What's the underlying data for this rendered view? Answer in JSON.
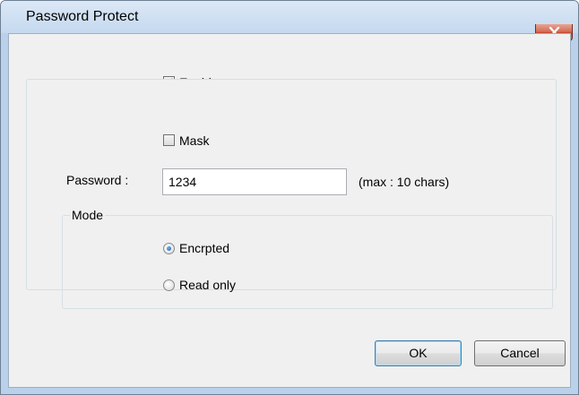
{
  "window": {
    "title": "Password Protect"
  },
  "enable": {
    "label": "Enable",
    "checked": true
  },
  "mask": {
    "label": "Mask",
    "checked": false
  },
  "password": {
    "label": "Password :",
    "value": "1234",
    "hint": "(max : 10 chars)"
  },
  "mode": {
    "title": "Mode",
    "options": [
      {
        "label": "Encrpted",
        "selected": true
      },
      {
        "label": "Read only",
        "selected": false
      }
    ]
  },
  "buttons": {
    "ok": "OK",
    "cancel": "Cancel"
  },
  "icons": {
    "close": "close-icon",
    "check": "checkmark-icon"
  },
  "colors": {
    "close_button": "#c4452b",
    "radio_selected": "#1a5fae",
    "default_button_border": "#3c7fb1"
  }
}
